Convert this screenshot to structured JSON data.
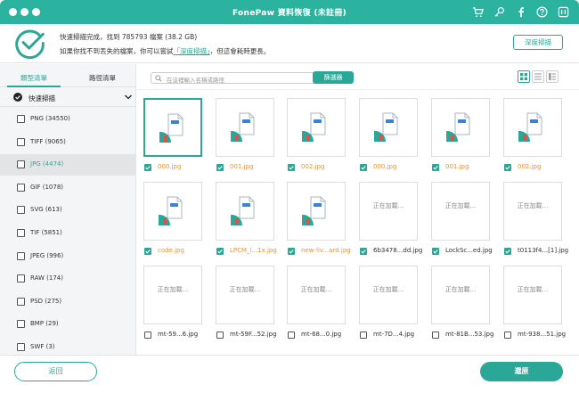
{
  "titlebar": {
    "title": "FonePaw 資料恢復 (未註冊)"
  },
  "header": {
    "status_line": "快速掃描完成，找到 785793 檔案 (38.2 GB)",
    "hint_prefix": "如果你找不到丟失的檔案，你可以嘗試",
    "hint_link": "「深度掃描」",
    "hint_suffix": "，但這會耗時更長。",
    "deep_scan_button": "深度掃描"
  },
  "sidebar": {
    "tabs": [
      "類型清單",
      "路徑清單"
    ],
    "active_tab": 0,
    "quick_scan_label": "快速掃描",
    "items": [
      {
        "label": "PNG (34550)",
        "selected": false
      },
      {
        "label": "TIFF (9065)",
        "selected": false
      },
      {
        "label": "JPG (4474)",
        "selected": true
      },
      {
        "label": "GIF (1078)",
        "selected": false
      },
      {
        "label": "SVG (613)",
        "selected": false
      },
      {
        "label": "TIF (5851)",
        "selected": false
      },
      {
        "label": "JPEG (996)",
        "selected": false
      },
      {
        "label": "RAW (174)",
        "selected": false
      },
      {
        "label": "PSD (275)",
        "selected": false
      },
      {
        "label": "BMP (29)",
        "selected": false
      },
      {
        "label": "SWF (3)",
        "selected": false
      }
    ]
  },
  "toolbar": {
    "search_placeholder": "在這裡輸入名稱或路徑",
    "filter_button": "篩選器"
  },
  "loading_text": "正在加載...",
  "files": [
    {
      "name": "000.jpg",
      "checked": true,
      "state": "icon",
      "orange": true
    },
    {
      "name": "001.jpg",
      "checked": true,
      "state": "icon",
      "orange": true
    },
    {
      "name": "002.jpg",
      "checked": true,
      "state": "icon",
      "orange": true
    },
    {
      "name": "000.jpg",
      "checked": true,
      "state": "icon",
      "orange": true
    },
    {
      "name": "001.jpg",
      "checked": true,
      "state": "icon",
      "orange": true
    },
    {
      "name": "002.jpg",
      "checked": true,
      "state": "icon",
      "orange": true
    },
    {
      "name": "code.jpg",
      "checked": true,
      "state": "icon",
      "orange": true
    },
    {
      "name": "LPCM_i...1x.jpg",
      "checked": true,
      "state": "icon",
      "orange": true
    },
    {
      "name": "new-liv...ard.jpg",
      "checked": true,
      "state": "icon",
      "orange": true
    },
    {
      "name": "6b3478...dd.jpg",
      "checked": true,
      "state": "loading",
      "orange": false
    },
    {
      "name": "LockSc...ed.jpg",
      "checked": true,
      "state": "loading",
      "orange": false
    },
    {
      "name": "t0113f4...[1].jpg",
      "checked": true,
      "state": "loading",
      "orange": false
    },
    {
      "name": "mt-59...6.jpg",
      "checked": false,
      "state": "loading",
      "orange": false
    },
    {
      "name": "mt-59F...52.jpg",
      "checked": false,
      "state": "loading",
      "orange": false
    },
    {
      "name": "mt-68...0.jpg",
      "checked": false,
      "state": "loading",
      "orange": false
    },
    {
      "name": "mt-7D...4.jpg",
      "checked": false,
      "state": "loading",
      "orange": false
    },
    {
      "name": "mt-81B...53.jpg",
      "checked": false,
      "state": "loading",
      "orange": false
    },
    {
      "name": "mt-938...51.jpg",
      "checked": false,
      "state": "loading",
      "orange": false
    }
  ],
  "footer": {
    "back_button": "返回",
    "restore_button": "還原"
  },
  "colors": {
    "accent": "#2aa797",
    "titlebar": "#2bb3a0",
    "file_name_highlight": "#e8913a"
  }
}
